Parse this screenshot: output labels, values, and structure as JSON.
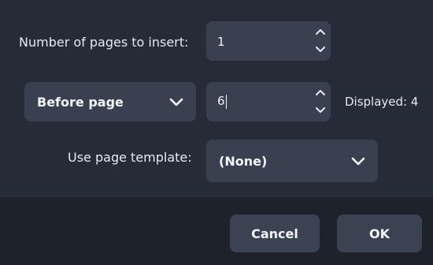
{
  "pages_to_insert": {
    "label": "Number of pages to insert:",
    "value": "1"
  },
  "position": {
    "dropdown_value": "Before page",
    "page_value": "6",
    "displayed_label": "Displayed: 4"
  },
  "template": {
    "label": "Use page template:",
    "dropdown_value": "(None)"
  },
  "footer": {
    "cancel_label": "Cancel",
    "ok_label": "OK"
  },
  "colors": {
    "dialog_bg": "#252b37",
    "footer_bg": "#1d222b",
    "field_bg": "#394150",
    "button_bg": "#3b4352",
    "text": "#e6e9ef"
  }
}
